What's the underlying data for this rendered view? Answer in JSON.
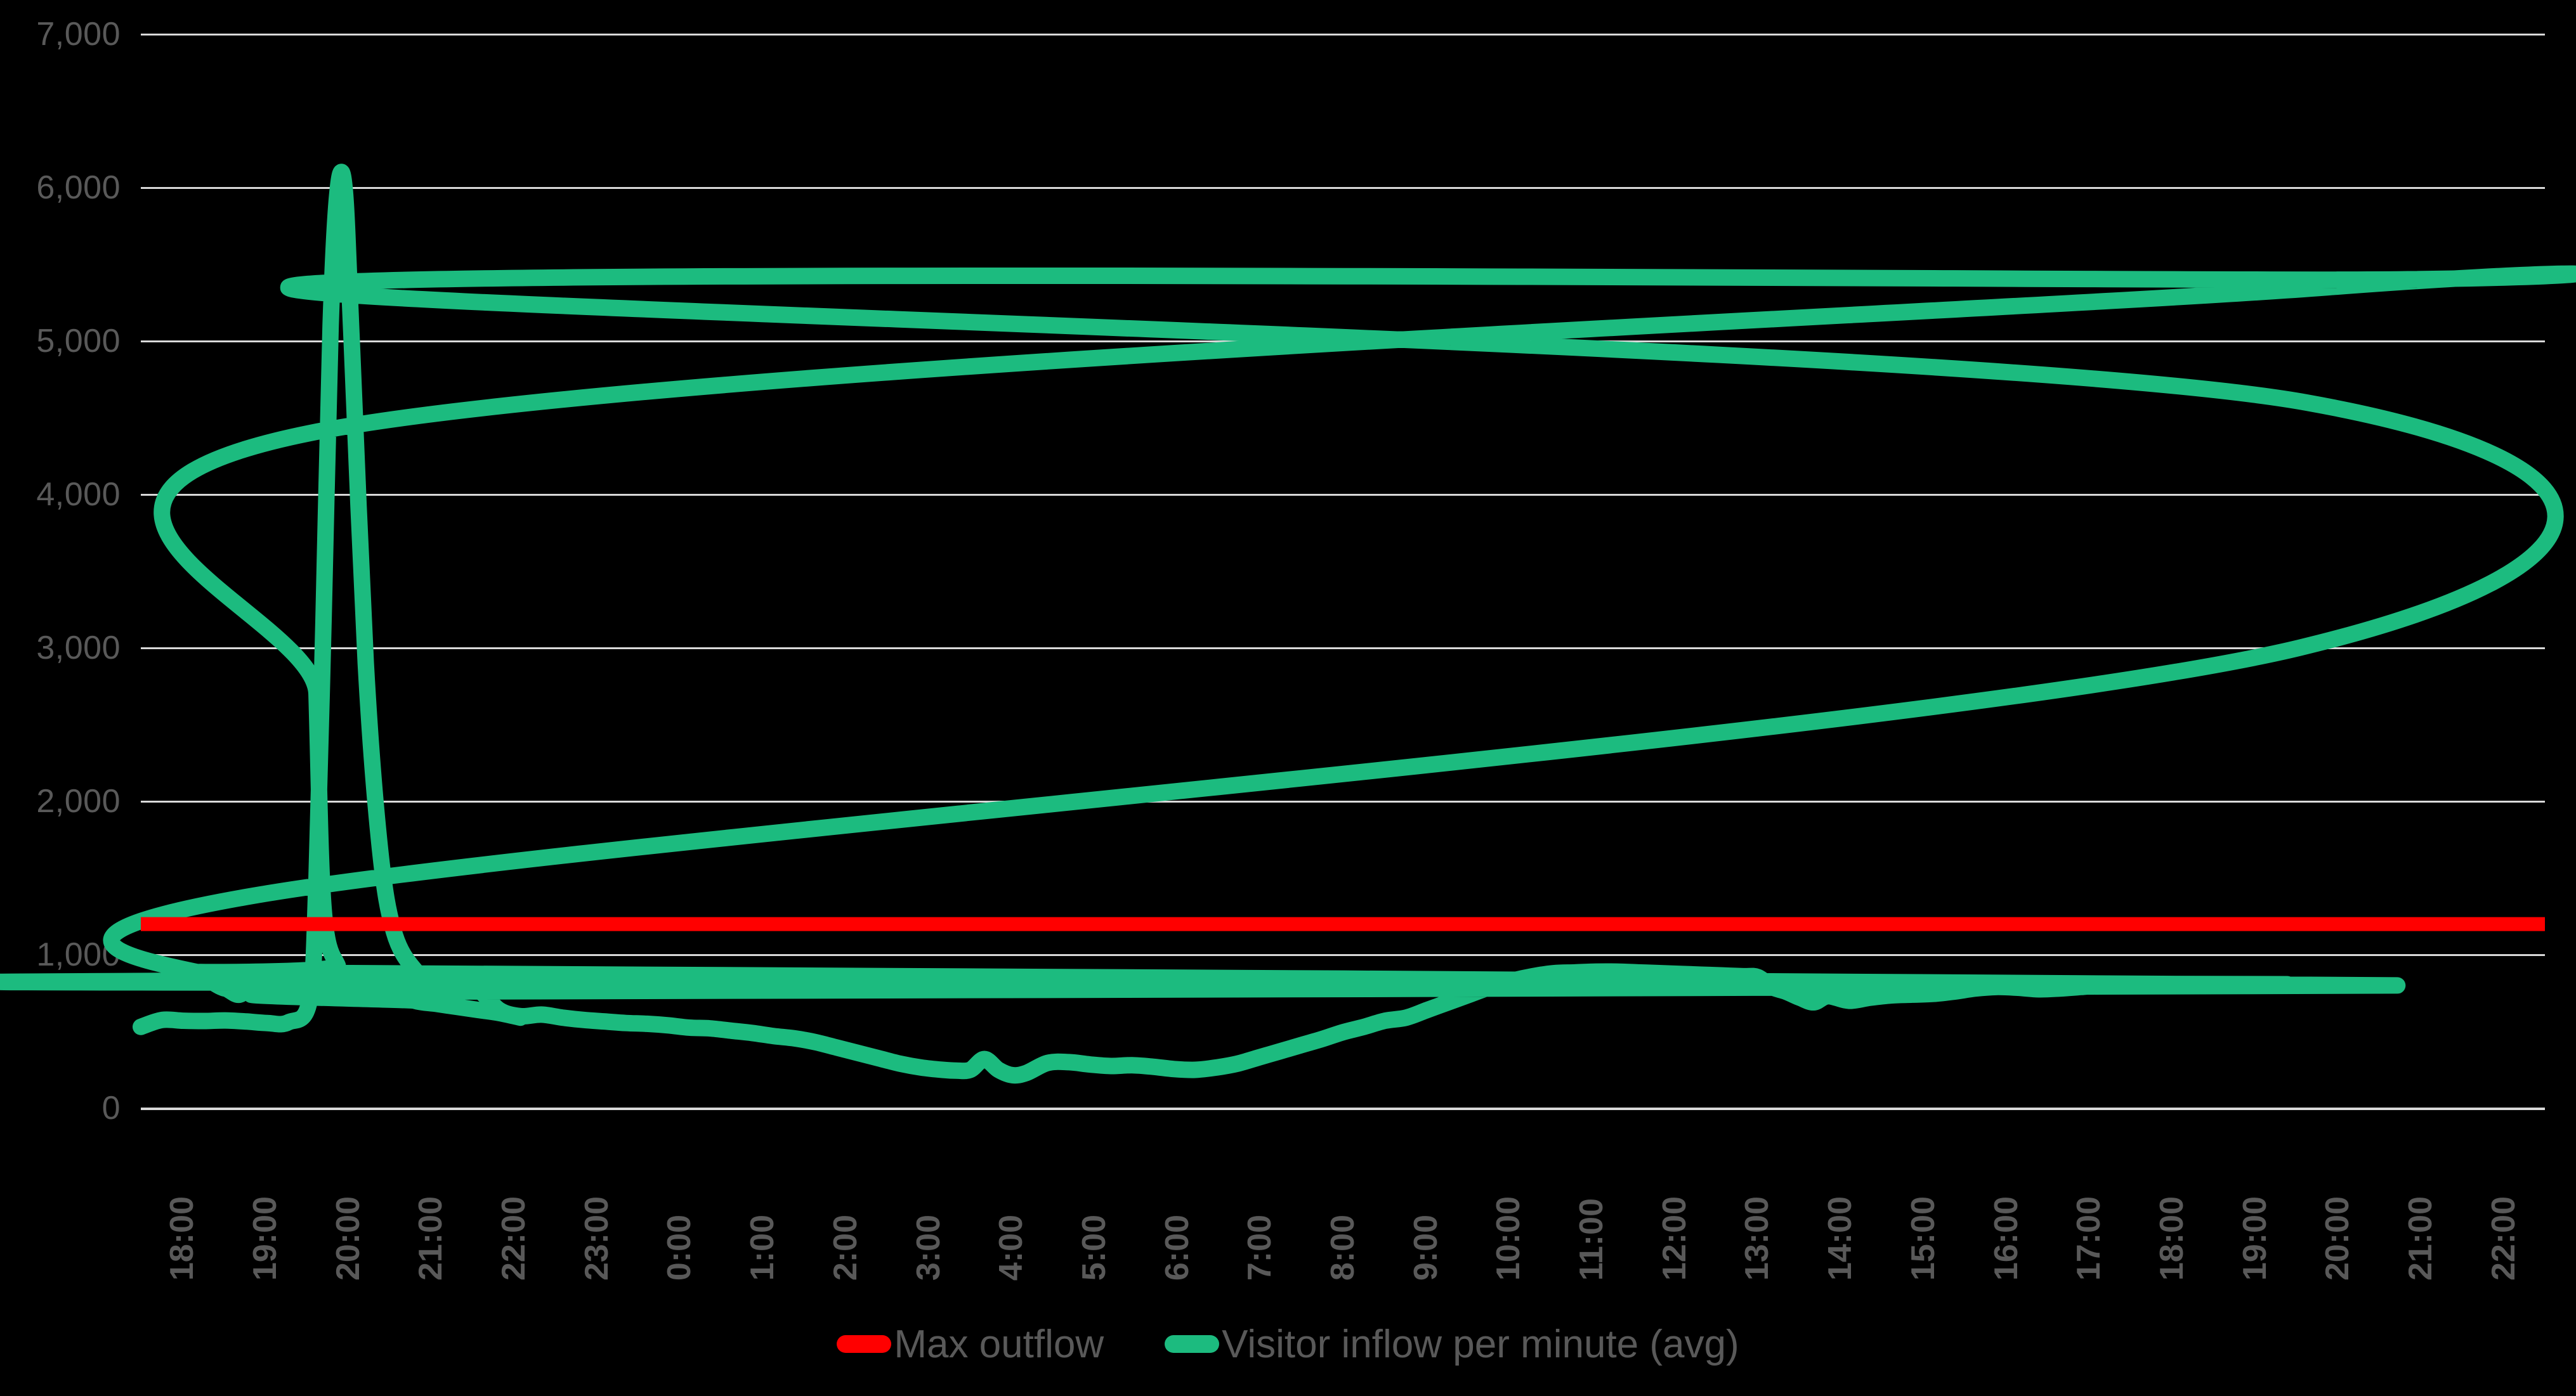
{
  "chart_data": {
    "type": "line",
    "title": "",
    "subtitle": "",
    "xlabel": "",
    "ylabel": "",
    "ylim": [
      0,
      7000
    ],
    "ytick_labels": [
      "7,000",
      "6,000",
      "5,000",
      "4,000",
      "3,000",
      "2,000",
      "1,000",
      "0"
    ],
    "ytick_values": [
      7000,
      6000,
      5000,
      4000,
      3000,
      2000,
      1000,
      0
    ],
    "grid": true,
    "grid_color": "#d9d9d9",
    "background_color": "#000000",
    "legend_position": "bottom-center",
    "xtick_labels": [
      "18:00",
      "19:00",
      "20:00",
      "21:00",
      "22:00",
      "23:00",
      "0:00",
      "1:00",
      "2:00",
      "3:00",
      "4:00",
      "5:00",
      "6:00",
      "7:00",
      "8:00",
      "9:00",
      "10:00",
      "11:00",
      "12:00",
      "13:00",
      "14:00",
      "15:00",
      "16:00",
      "17:00",
      "18:00",
      "19:00",
      "20:00",
      "21:00",
      "22:00"
    ],
    "series": [
      {
        "name": "Max outflow",
        "color": "#ff0000",
        "type": "constant-threshold",
        "value": 1200
      },
      {
        "name": "Visitor inflow per minute (avg)",
        "color": "#1cbb7f",
        "type": "line",
        "x": [
          "18:00",
          "18:15",
          "18:30",
          "18:45",
          "19:00",
          "19:15",
          "19:30",
          "19:45",
          "20:00",
          "20:05",
          "20:10",
          "20:15",
          "20:20",
          "20:25",
          "20:30",
          "20:40",
          "20:50",
          "21:00",
          "21:15",
          "21:30",
          "21:45",
          "22:00",
          "22:15",
          "22:30",
          "22:45",
          "23:00",
          "23:15",
          "23:30",
          "23:45",
          "0:00",
          "0:15",
          "0:30",
          "0:45",
          "1:00",
          "1:15",
          "1:30",
          "1:45",
          "2:00",
          "2:15",
          "2:30",
          "2:45",
          "3:00",
          "3:15",
          "3:30",
          "3:40",
          "3:50",
          "4:00",
          "4:10",
          "4:20",
          "4:30",
          "4:45",
          "5:00",
          "5:15",
          "5:30",
          "5:45",
          "6:00",
          "6:15",
          "6:30",
          "6:45",
          "7:00",
          "7:15",
          "7:30",
          "7:45",
          "8:00",
          "8:15",
          "8:30",
          "8:45",
          "9:00",
          "9:15",
          "9:30",
          "9:45",
          "10:00",
          "10:15",
          "10:30",
          "10:45",
          "11:00",
          "11:15",
          "11:30",
          "11:45",
          "12:00",
          "12:15",
          "12:30",
          "12:45",
          "13:00",
          "13:10",
          "13:20",
          "13:30",
          "13:40",
          "13:50",
          "14:00",
          "14:15",
          "14:30",
          "14:45",
          "15:00",
          "15:15",
          "15:30",
          "15:45",
          "16:00",
          "16:15",
          "16:30",
          "16:45",
          "17:00",
          "17:15",
          "17:30",
          "17:45",
          "18:00",
          "18:15",
          "18:30",
          "18:45",
          "19:00",
          "19:15",
          "19:30",
          "19:35",
          "19:40",
          "19:45",
          "19:50",
          "19:55",
          "20:00",
          "20:05",
          "20:10",
          "20:20",
          "20:30",
          "20:45",
          "21:00",
          "21:15",
          "21:30",
          "21:45",
          "22:00",
          "22:15",
          "22:30"
        ],
        "y": [
          530,
          575,
          570,
          568,
          572,
          565,
          555,
          560,
          700,
          1500,
          3200,
          5100,
          5980,
          5990,
          5000,
          2900,
          1700,
          1150,
          900,
          820,
          790,
          770,
          640,
          600,
          610,
          590,
          575,
          565,
          555,
          550,
          540,
          525,
          520,
          505,
          490,
          470,
          455,
          430,
          395,
          360,
          325,
          290,
          265,
          250,
          245,
          250,
          320,
          250,
          215,
          230,
          295,
          300,
          285,
          275,
          280,
          270,
          255,
          250,
          265,
          290,
          330,
          370,
          410,
          450,
          495,
          530,
          570,
          590,
          640,
          690,
          740,
          790,
          830,
          860,
          880,
          885,
          890,
          890,
          885,
          880,
          875,
          870,
          865,
          860,
          855,
          790,
          760,
          720,
          690,
          730,
          700,
          720,
          735,
          740,
          745,
          760,
          780,
          790,
          785,
          775,
          780,
          790,
          800,
          805,
          810,
          820,
          830,
          840,
          845,
          780,
          790,
          1400,
          3000,
          4600,
          5350,
          5400,
          5350,
          4400,
          2700,
          1300,
          930,
          880,
          800,
          760,
          700,
          680,
          660,
          640,
          620,
          590,
          585
        ],
        "peaks": [
          {
            "time": "20:15",
            "value": 5990
          },
          {
            "time": "19:45",
            "value": 5400
          }
        ],
        "minimum": {
          "time": "4:20",
          "value": 215
        }
      }
    ]
  },
  "legend": {
    "items": [
      {
        "label": "Max outflow",
        "color": "#ff0000"
      },
      {
        "label": "Visitor inflow per minute (avg)",
        "color": "#1cbb7f"
      }
    ]
  }
}
